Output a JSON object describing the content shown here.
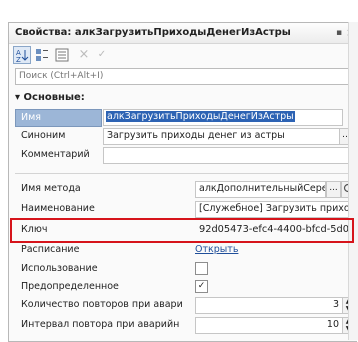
{
  "window": {
    "title": "Свойства: алкЗагрузитьПриходыДенегИзАстры",
    "close_glyph": "×",
    "pin_glyph": "▪"
  },
  "toolbar": {
    "sort_icon": "sort-alpha-icon",
    "category_icon": "category-icon",
    "list_icon": "list-icon",
    "close_glyph": "×",
    "check_glyph": "✓"
  },
  "search": {
    "placeholder": "Поиск (Ctrl+Alt+I)"
  },
  "section": {
    "title": "Основные:",
    "toggle": "▾"
  },
  "properties": {
    "name": {
      "label": "Имя",
      "value": "алкЗагрузитьПриходыДенегИзАстры"
    },
    "synonym": {
      "label": "Синоним",
      "value": "Загрузить приходы денег из астры"
    },
    "comment": {
      "label": "Комментарий",
      "value": ""
    },
    "method": {
      "label": "Имя метода",
      "value": "алкДополнительныйСере",
      "button": "..."
    },
    "description": {
      "label": "Наименование",
      "value": "[Служебное] Загрузить приходь"
    },
    "key": {
      "label": "Ключ",
      "value": "92d05473-efc4-4400-bfcd-5d0fe0"
    },
    "schedule": {
      "label": "Расписание",
      "link": "Открыть"
    },
    "use": {
      "label": "Использование",
      "checked": false
    },
    "predefined": {
      "label": "Предопределенное",
      "checked": true,
      "mark": "✓"
    },
    "retry_count": {
      "label": "Количество повторов при авари",
      "value": "3"
    },
    "retry_interval": {
      "label": "Интервал повтора при аварийн",
      "value": "10"
    }
  },
  "spin": {
    "up": "▲",
    "down": "▼"
  },
  "colors": {
    "highlight": "#d6141b",
    "selection": "#2d63b4",
    "label_active": "#9cb6d7"
  }
}
